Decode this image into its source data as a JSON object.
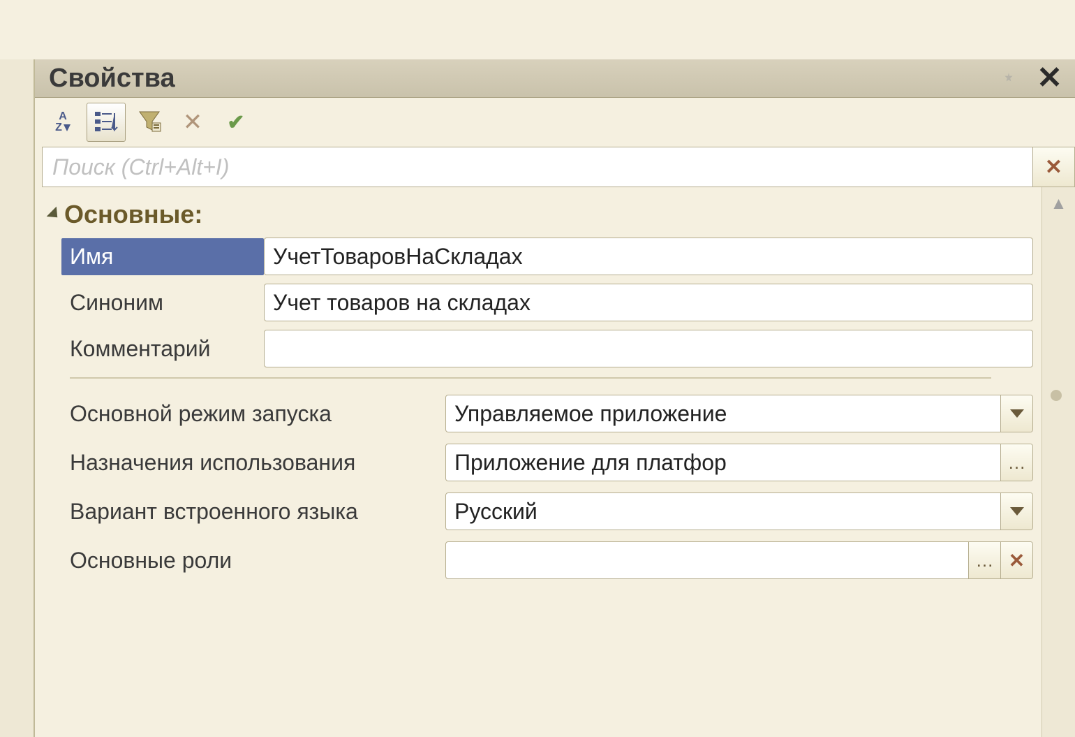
{
  "panel": {
    "title": "Свойства"
  },
  "search": {
    "placeholder": "Поиск (Ctrl+Alt+I)"
  },
  "section": {
    "title": "Основные:"
  },
  "labels": {
    "name": "Имя",
    "synonym": "Синоним",
    "comment": "Комментарий",
    "launch_mode": "Основной режим запуска",
    "usage_assignments": "Назначения использования",
    "language_variant": "Вариант встроенного языка",
    "main_roles": "Основные роли"
  },
  "values": {
    "name": "УчетТоваровНаСкладах",
    "synonym": "Учет товаров на складах",
    "comment": "",
    "launch_mode": "Управляемое приложение",
    "usage_assignments": "Приложение для платфор",
    "language_variant": "Русский",
    "main_roles": ""
  }
}
